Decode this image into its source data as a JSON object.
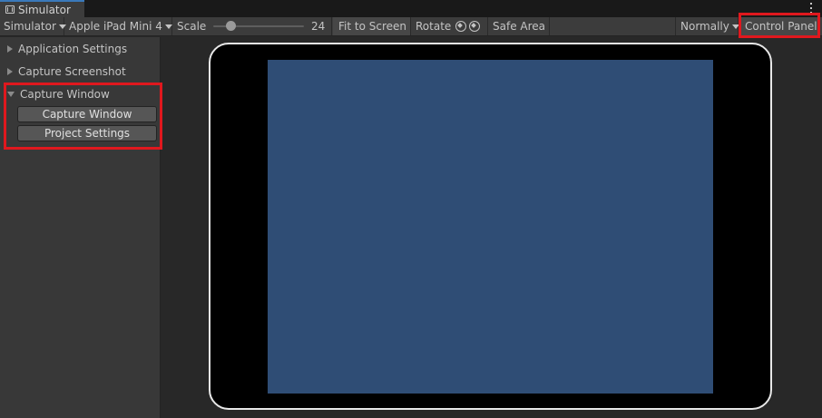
{
  "window": {
    "tab_title": "Simulator"
  },
  "toolbar": {
    "mode": "Simulator",
    "device": "Apple iPad Mini 4",
    "scale_label": "Scale",
    "scale_value": "24",
    "fit_to_screen": "Fit to Screen",
    "rotate": "Rotate",
    "safe_area": "Safe Area",
    "orientation": "Normally",
    "control_panel": "Control Panel"
  },
  "sidebar": {
    "sections": [
      {
        "label": "Application Settings",
        "expanded": false
      },
      {
        "label": "Capture Screenshot",
        "expanded": false
      },
      {
        "label": "Capture Window",
        "expanded": true
      }
    ],
    "capture_window_button": "Capture Window",
    "project_settings_button": "Project Settings"
  },
  "colors": {
    "highlight": "#e0181e",
    "device_screen": "#2f4d75",
    "tab_accent": "#3a79bb"
  }
}
